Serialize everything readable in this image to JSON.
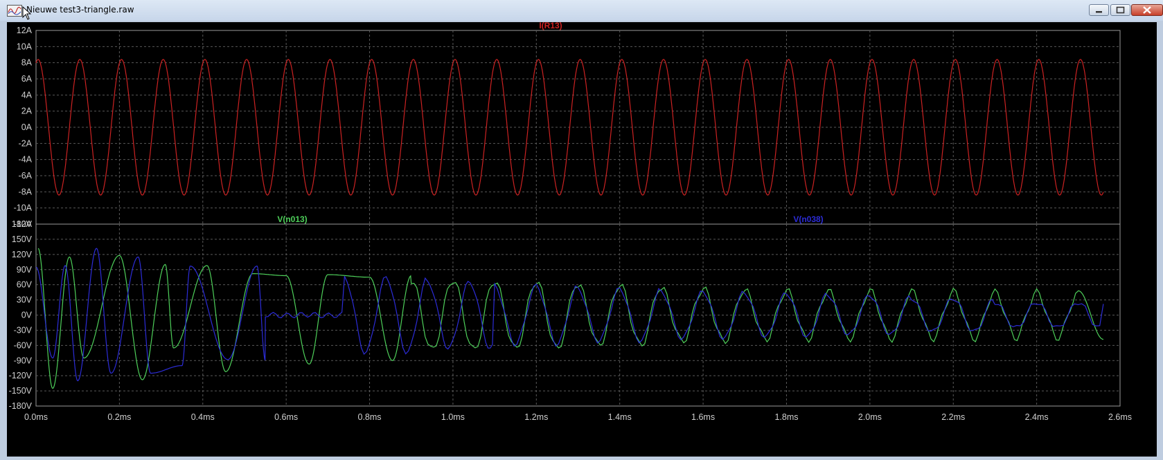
{
  "window": {
    "title": "Nieuwe test3-triangle.raw",
    "icon": "waveform-app-icon",
    "buttons": [
      "minimize",
      "maximize",
      "close"
    ]
  },
  "colors": {
    "background": "#000000",
    "grid": "#5a5a5a",
    "axis_text": "#d0d0d0",
    "current_trace": "#cc2222",
    "v_n013": "#4ed05a",
    "v_n038": "#2c2cd8"
  },
  "chart_data": [
    {
      "type": "line",
      "name": "top-pane",
      "series": [
        {
          "name": "I(R13)",
          "color": "#cc2222",
          "amplitude": 8.4,
          "period_ms": 0.1,
          "start_value": 8,
          "end_value": -6
        }
      ],
      "x": {
        "min": 0,
        "max": 2.6,
        "unit": "ms"
      },
      "ylim": [
        -12,
        12
      ],
      "yticks": [
        "12A",
        "10A",
        "8A",
        "6A",
        "4A",
        "2A",
        "0A",
        "-2A",
        "-4A",
        "-6A",
        "-8A",
        "-10A",
        "-12A"
      ],
      "grid": true
    },
    {
      "type": "line",
      "name": "bottom-pane",
      "series": [
        {
          "name": "V(n013)",
          "color": "#4ed05a",
          "peaks": [
            [
              0.005,
              132
            ],
            [
              0.04,
              -145
            ],
            [
              0.08,
              115
            ],
            [
              0.115,
              -85
            ],
            [
              0.2,
              118
            ],
            [
              0.255,
              -128
            ],
            [
              0.31,
              100
            ],
            [
              0.33,
              -65
            ],
            [
              0.41,
              98
            ],
            [
              0.455,
              -112
            ],
            [
              0.52,
              82
            ],
            [
              0.6,
              78
            ],
            [
              0.655,
              -97
            ],
            [
              0.7,
              80
            ],
            [
              0.8,
              75
            ],
            [
              0.855,
              -90
            ],
            [
              0.9,
              78
            ],
            [
              1.1,
              78
            ],
            [
              1.3,
              72
            ],
            [
              1.5,
              62
            ],
            [
              1.7,
              55
            ],
            [
              1.9,
              52
            ],
            [
              2.1,
              52
            ],
            [
              2.3,
              50
            ],
            [
              2.5,
              48
            ],
            [
              2.56,
              -48
            ]
          ]
        },
        {
          "name": "V(n038)",
          "color": "#2c2cd8",
          "peaks": [
            [
              0.0,
              95
            ],
            [
              0.04,
              -85
            ],
            [
              0.07,
              98
            ],
            [
              0.1,
              -130
            ],
            [
              0.145,
              132
            ],
            [
              0.18,
              -115
            ],
            [
              0.245,
              115
            ],
            [
              0.275,
              -115
            ],
            [
              0.35,
              -100
            ],
            [
              0.37,
              97
            ],
            [
              0.46,
              -88
            ],
            [
              0.53,
              97
            ],
            [
              0.55,
              -90
            ],
            [
              0.74,
              88
            ],
            [
              0.94,
              78
            ],
            [
              1.1,
              68
            ],
            [
              1.3,
              60
            ],
            [
              1.5,
              55
            ],
            [
              1.7,
              48
            ],
            [
              1.9,
              48
            ],
            [
              2.1,
              40
            ],
            [
              2.3,
              35
            ],
            [
              2.56,
              22
            ]
          ]
        }
      ],
      "x": {
        "min": 0,
        "max": 2.6,
        "unit": "ms"
      },
      "xticks": [
        "0.0ms",
        "0.2ms",
        "0.4ms",
        "0.6ms",
        "0.8ms",
        "1.0ms",
        "1.2ms",
        "1.4ms",
        "1.6ms",
        "1.8ms",
        "2.0ms",
        "2.2ms",
        "2.4ms",
        "2.6ms"
      ],
      "ylim": [
        -180,
        180
      ],
      "yticks": [
        "180V",
        "150V",
        "120V",
        "90V",
        "60V",
        "30V",
        "0V",
        "-30V",
        "-60V",
        "-90V",
        "-120V",
        "-150V",
        "-180V"
      ],
      "grid": true
    }
  ]
}
